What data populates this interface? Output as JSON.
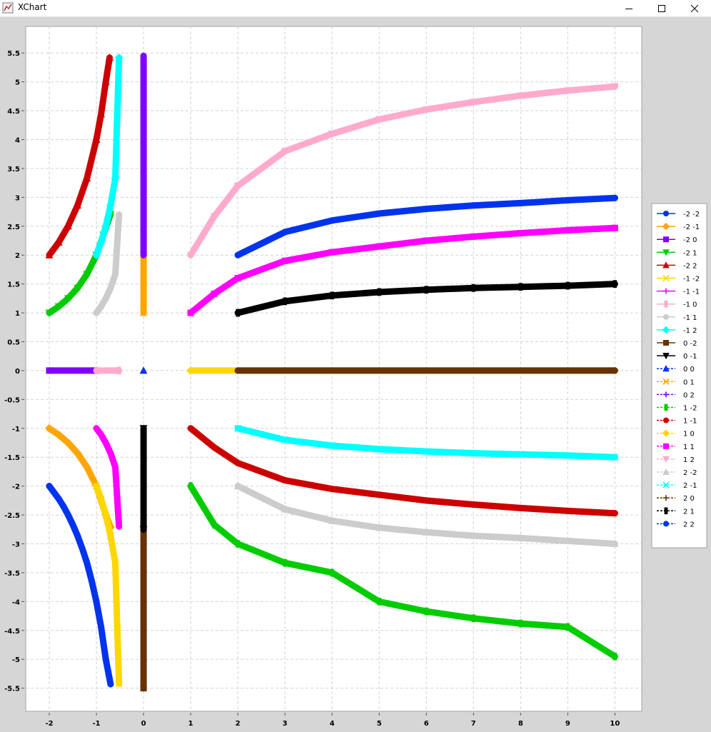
{
  "window": {
    "title": "XChart",
    "buttons": {
      "minimize": "minimize",
      "maximize": "maximize",
      "close": "close"
    }
  },
  "chart_data": {
    "type": "line",
    "title": "",
    "xlabel": "",
    "ylabel": "",
    "xlim": [
      -2.5,
      10.57
    ],
    "ylim": [
      -5.9,
      5.96
    ],
    "grid": true,
    "legend_position": "right",
    "x_ticks": [
      "-2",
      "-1",
      "0",
      "1",
      "2",
      "3",
      "4",
      "5",
      "6",
      "7",
      "8",
      "9",
      "10"
    ],
    "y_ticks": [
      "5.5",
      "5",
      "4.5",
      "4",
      "3.5",
      "3",
      "2.5",
      "2",
      "1.5",
      "1",
      "0.5",
      "0",
      "-0.5",
      "-1",
      "-1.5",
      "-2",
      "-2.5",
      "-3",
      "-3.5",
      "-4",
      "-4.5",
      "-5",
      "-5.5"
    ],
    "series": [
      {
        "name": "-2 -2",
        "color": "#0033ee",
        "marker": "circle",
        "dashed": false,
        "x": [
          -2,
          -1.9,
          -1.8,
          -1.7,
          -1.6,
          -1.5,
          -1.4,
          -1.3,
          -1.2,
          -1.1,
          -1.0,
          -0.9,
          -0.8,
          -0.7
        ],
        "y": [
          -2.0,
          -2.11,
          -2.22,
          -2.35,
          -2.5,
          -2.67,
          -2.86,
          -3.08,
          -3.33,
          -3.64,
          -4.0,
          -4.44,
          -5.0,
          -5.43
        ]
      },
      {
        "name": "-2 -1",
        "color": "#ffa500",
        "marker": "diamond",
        "dashed": false,
        "x": [
          -2,
          -1.8,
          -1.6,
          -1.4,
          -1.2,
          -1.0,
          -0.8,
          -0.7
        ],
        "y": [
          -1.0,
          -1.11,
          -1.25,
          -1.43,
          -1.67,
          -2.0,
          -2.5,
          -2.71
        ]
      },
      {
        "name": "-2 0",
        "color": "#8000ff",
        "marker": "square",
        "dashed": false,
        "x": [
          -2,
          -1.05
        ],
        "y": [
          0,
          0
        ]
      },
      {
        "name": "-2 1",
        "color": "#00cc00",
        "marker": "triangle-down",
        "dashed": false,
        "x": [
          -2,
          -1.8,
          -1.6,
          -1.4,
          -1.2,
          -1.0,
          -0.85,
          -0.7
        ],
        "y": [
          1.0,
          1.11,
          1.25,
          1.43,
          1.67,
          2.0,
          2.35,
          2.71
        ]
      },
      {
        "name": "-2 2",
        "color": "#cc0000",
        "marker": "triangle-up",
        "dashed": false,
        "x": [
          -2,
          -1.8,
          -1.6,
          -1.4,
          -1.2,
          -1.0,
          -0.9,
          -0.8,
          -0.72
        ],
        "y": [
          2.0,
          2.22,
          2.5,
          2.86,
          3.33,
          4.0,
          4.44,
          5.0,
          5.42
        ]
      },
      {
        "name": "-1 -2",
        "color": "#ffd700",
        "marker": "x",
        "dashed": false,
        "x": [
          -1.0,
          -0.9,
          -0.8,
          -0.7,
          -0.6,
          -0.52
        ],
        "y": [
          -2.0,
          -2.22,
          -2.5,
          -2.86,
          -3.33,
          -5.42
        ]
      },
      {
        "name": "-1 -1",
        "color": "#ff00ff",
        "marker": "plus",
        "dashed": false,
        "x": [
          -1.0,
          -0.9,
          -0.8,
          -0.7,
          -0.6,
          -0.52
        ],
        "y": [
          -1.0,
          -1.11,
          -1.25,
          -1.43,
          -1.67,
          -2.7
        ]
      },
      {
        "name": "-1 0",
        "color": "#ffaacc",
        "marker": "bar",
        "dashed": false,
        "x": [
          -1.0,
          -0.52
        ],
        "y": [
          0,
          0
        ]
      },
      {
        "name": "-1 1",
        "color": "#cccccc",
        "marker": "circle",
        "dashed": false,
        "x": [
          -1.0,
          -0.9,
          -0.8,
          -0.7,
          -0.6,
          -0.52
        ],
        "y": [
          1.0,
          1.11,
          1.25,
          1.43,
          1.67,
          2.7
        ]
      },
      {
        "name": "-1 2",
        "color": "#00ffff",
        "marker": "diamond",
        "dashed": false,
        "x": [
          -1.0,
          -0.9,
          -0.8,
          -0.7,
          -0.6,
          -0.52
        ],
        "y": [
          2.0,
          2.22,
          2.5,
          2.86,
          3.33,
          5.42
        ]
      },
      {
        "name": "0 -2",
        "color": "#663300",
        "marker": "square",
        "dashed": false,
        "x": [
          0,
          0
        ],
        "y": [
          -2.75,
          -5.5
        ]
      },
      {
        "name": "0 -1",
        "color": "#000000",
        "marker": "triangle-down",
        "dashed": false,
        "x": [
          0,
          0
        ],
        "y": [
          -1.0,
          -2.75
        ]
      },
      {
        "name": "0 0",
        "color": "#0033ee",
        "marker": "triangle-up",
        "dashed": true,
        "x": [
          0
        ],
        "y": [
          0
        ]
      },
      {
        "name": "0 1",
        "color": "#ffa500",
        "marker": "x",
        "dashed": true,
        "x": [
          0,
          0
        ],
        "y": [
          1.0,
          2.0
        ]
      },
      {
        "name": "0 2",
        "color": "#8000ff",
        "marker": "plus",
        "dashed": true,
        "x": [
          0,
          0
        ],
        "y": [
          2.0,
          5.45
        ]
      },
      {
        "name": "1 -2",
        "color": "#00cc00",
        "marker": "bar",
        "dashed": true,
        "x": [
          1,
          1.5,
          2,
          3,
          4,
          5,
          6,
          7,
          8,
          9,
          10
        ],
        "y": [
          -2.0,
          -2.67,
          -3.0,
          -3.33,
          -3.5,
          -4.0,
          -4.17,
          -4.29,
          -4.38,
          -4.44,
          -4.95
        ]
      },
      {
        "name": "1 -1",
        "color": "#cc0000",
        "marker": "circle",
        "dashed": true,
        "x": [
          1,
          1.5,
          2,
          3,
          4,
          5,
          6,
          7,
          8,
          9,
          10
        ],
        "y": [
          -1.0,
          -1.33,
          -1.6,
          -1.9,
          -2.05,
          -2.15,
          -2.25,
          -2.32,
          -2.38,
          -2.43,
          -2.47
        ]
      },
      {
        "name": "1 0",
        "color": "#ffd700",
        "marker": "diamond",
        "dashed": true,
        "x": [
          1,
          10
        ],
        "y": [
          0,
          0
        ]
      },
      {
        "name": "1 1",
        "color": "#ff00ff",
        "marker": "square",
        "dashed": true,
        "x": [
          1,
          1.5,
          2,
          3,
          4,
          5,
          6,
          7,
          8,
          9,
          10
        ],
        "y": [
          1.0,
          1.33,
          1.6,
          1.9,
          2.05,
          2.15,
          2.25,
          2.32,
          2.38,
          2.43,
          2.47
        ]
      },
      {
        "name": "1 2",
        "color": "#ffaacc",
        "marker": "triangle-down",
        "dashed": true,
        "x": [
          1,
          1.5,
          2,
          3,
          4,
          5,
          6,
          7,
          8,
          9,
          10
        ],
        "y": [
          2.0,
          2.67,
          3.2,
          3.8,
          4.1,
          4.35,
          4.52,
          4.65,
          4.76,
          4.85,
          4.92
        ]
      },
      {
        "name": "2 -2",
        "color": "#cccccc",
        "marker": "triangle-up",
        "dashed": true,
        "x": [
          2,
          3,
          4,
          5,
          6,
          7,
          8,
          9,
          10
        ],
        "y": [
          -2.0,
          -2.4,
          -2.6,
          -2.72,
          -2.8,
          -2.86,
          -2.9,
          -2.95,
          -3.0
        ]
      },
      {
        "name": "2 -1",
        "color": "#00ffff",
        "marker": "x",
        "dashed": true,
        "x": [
          2,
          3,
          4,
          5,
          6,
          7,
          8,
          9,
          10
        ],
        "y": [
          -1.0,
          -1.2,
          -1.3,
          -1.36,
          -1.4,
          -1.43,
          -1.45,
          -1.47,
          -1.5
        ]
      },
      {
        "name": "2 0",
        "color": "#663300",
        "marker": "plus",
        "dashed": true,
        "x": [
          2,
          10
        ],
        "y": [
          0,
          0
        ]
      },
      {
        "name": "2 1",
        "color": "#000000",
        "marker": "bar",
        "dashed": true,
        "x": [
          2,
          3,
          4,
          5,
          6,
          7,
          8,
          9,
          10
        ],
        "y": [
          1.0,
          1.2,
          1.3,
          1.36,
          1.4,
          1.43,
          1.45,
          1.47,
          1.5
        ]
      },
      {
        "name": "2 2",
        "color": "#0033ee",
        "marker": "circle",
        "dashed": true,
        "x": [
          2,
          3,
          4,
          5,
          6,
          7,
          8,
          9,
          10
        ],
        "y": [
          2.0,
          2.4,
          2.6,
          2.72,
          2.8,
          2.86,
          2.9,
          2.95,
          2.99
        ]
      }
    ]
  }
}
